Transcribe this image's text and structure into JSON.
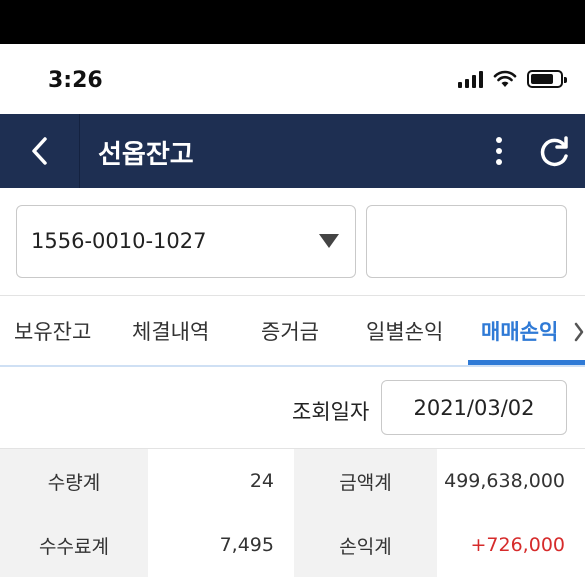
{
  "status_bar": {
    "time": "3:26",
    "icons": [
      "cellular-signal-icon",
      "wifi-icon",
      "battery-icon"
    ]
  },
  "navbar": {
    "back_icon": "chevron-left-icon",
    "title": "선옵잔고",
    "more_icon": "more-vertical-icon",
    "refresh_icon": "refresh-icon",
    "background": "#1e2f52"
  },
  "account": {
    "number": "1556-0010-1027",
    "password_value": ""
  },
  "tabs": [
    {
      "label": "보유잔고",
      "active": false
    },
    {
      "label": "체결내역",
      "active": false
    },
    {
      "label": "증거금",
      "active": false
    },
    {
      "label": "일별손익",
      "active": false
    },
    {
      "label": "매매손익",
      "active": true
    }
  ],
  "query": {
    "label": "조회일자",
    "date": "2021/03/02"
  },
  "summary": {
    "qty_label": "수량계",
    "qty_value": "24",
    "amount_label": "금액계",
    "amount_value": "499,638,000",
    "fee_label": "수수료계",
    "fee_value": "7,495",
    "pnl_label": "손익계",
    "pnl_value": "+726,000"
  },
  "colors": {
    "accent": "#2f7ad6",
    "profit": "#d62b2b"
  }
}
